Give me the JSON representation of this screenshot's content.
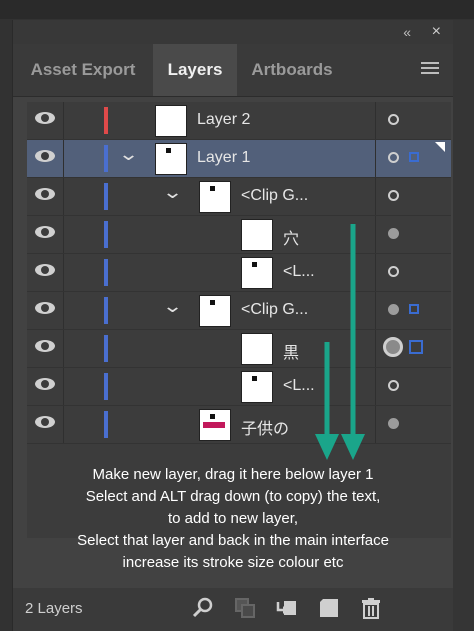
{
  "panel": {
    "tabs": [
      {
        "label": "Asset Export",
        "active": false
      },
      {
        "label": "Layers",
        "active": true
      },
      {
        "label": "Artboards",
        "active": false
      }
    ],
    "collapse_glyph": "«",
    "close_glyph": "×"
  },
  "layers": [
    {
      "name": "Layer 2",
      "color": "#e04a4a",
      "expanded": null,
      "selected": false,
      "target": "outline",
      "sel_square": false
    },
    {
      "name": "Layer 1",
      "color": "#4a6fd0",
      "expanded": true,
      "selected": true,
      "target": "outline",
      "sel_square": true
    },
    {
      "name": "<Clip G...",
      "color": "#4a6fd0",
      "expanded": true,
      "selected": false,
      "target": "outline",
      "sel_square": false
    },
    {
      "name": "穴",
      "color": "#4a6fd0",
      "expanded": null,
      "selected": false,
      "target": "filled",
      "sel_square": false
    },
    {
      "name": "<L...",
      "color": "#4a6fd0",
      "expanded": null,
      "selected": false,
      "target": "outline",
      "sel_square": false
    },
    {
      "name": "<Clip G...",
      "color": "#4a6fd0",
      "expanded": true,
      "selected": false,
      "target": "filled",
      "sel_square": true
    },
    {
      "name": "黒",
      "color": "#4a6fd0",
      "expanded": null,
      "selected": false,
      "target": "big",
      "sel_square": true
    },
    {
      "name": "<L...",
      "color": "#4a6fd0",
      "expanded": null,
      "selected": false,
      "target": "outline",
      "sel_square": false
    },
    {
      "name": "子供の",
      "color": "#4a6fd0",
      "expanded": null,
      "selected": false,
      "target": "filled",
      "sel_square": false
    }
  ],
  "annotation": {
    "lines": [
      "Make new layer, drag it here below layer 1",
      "Select  and ALT drag down  (to copy) the text,",
      "to add to new layer,",
      "Select that layer and back in the main interface",
      "increase its stroke size colour etc"
    ],
    "arrow_color": "#1aa58a"
  },
  "footer": {
    "count": "2 Layers",
    "icons": [
      "search-icon",
      "make-clipping-mask-icon",
      "create-sublayer-icon",
      "new-layer-icon",
      "trash-icon"
    ]
  }
}
